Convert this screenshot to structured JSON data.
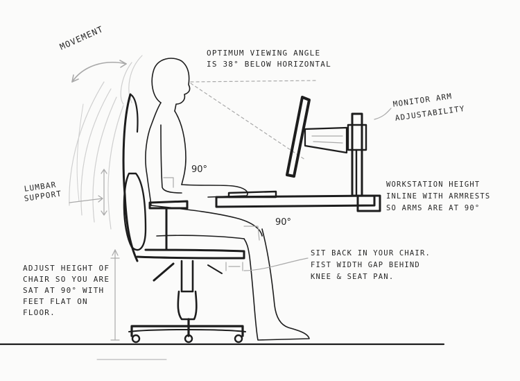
{
  "labels": {
    "movement": "MOVEMENT",
    "viewing_angle": [
      "OPTIMUM VIEWING ANGLE",
      "IS 38° BELOW HORIZONTAL"
    ],
    "monitor_arm": [
      "MONITOR ARM",
      "ADJUSTABILITY"
    ],
    "workstation": [
      "WORKSTATION HEIGHT",
      "INLINE WITH ARMRESTS",
      "SO ARMS ARE AT 90°"
    ],
    "lumbar": [
      "LUMBAR",
      "SUPPORT"
    ],
    "adjust_height": [
      "ADJUST HEIGHT OF",
      "CHAIR SO YOU ARE",
      "SAT AT 90° WITH",
      "FEET FLAT ON",
      "FLOOR."
    ],
    "sit_back": [
      "SIT BACK IN YOUR CHAIR.",
      "FIST WIDTH GAP BEHIND",
      "KNEE & SEAT PAN."
    ],
    "elbow_angle": "90°",
    "knee_angle": "90°"
  },
  "style": {
    "ink": "#1d1d1d",
    "pencil": "#a9a9a9",
    "paper": "#fbfbfa"
  }
}
